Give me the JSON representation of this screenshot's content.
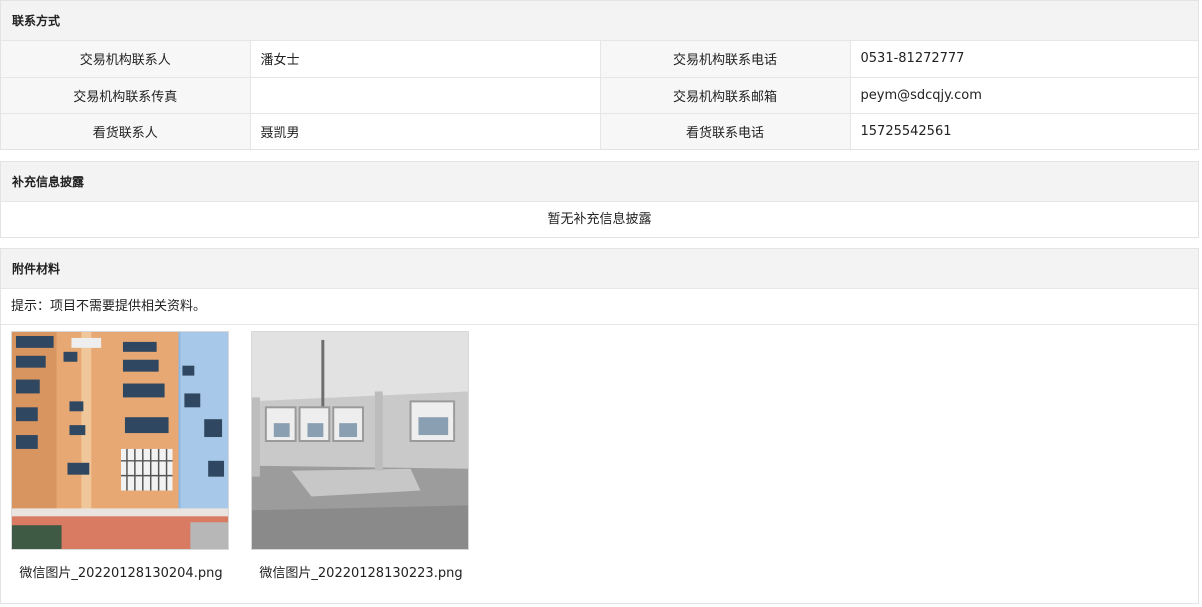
{
  "contact": {
    "title": "联系方式",
    "rows": [
      {
        "label1": "交易机构联系人",
        "value1": "潘女士",
        "label2": "交易机构联系电话",
        "value2": "0531-81272777"
      },
      {
        "label1": "交易机构联系传真",
        "value1": "",
        "label2": "交易机构联系邮箱",
        "value2": "peym@sdcqjy.com"
      },
      {
        "label1": "看货联系人",
        "value1": "聂凯男",
        "label2": "看货联系电话",
        "value2": "15725542561"
      }
    ]
  },
  "supplement": {
    "title": "补充信息披露",
    "empty_text": "暂无补充信息披露"
  },
  "attachments": {
    "title": "附件材料",
    "hint": "提示：项目不需要提供相关资料。",
    "files": [
      {
        "name": "微信图片_20220128130204.png"
      },
      {
        "name": "微信图片_20220128130223.png"
      }
    ]
  }
}
